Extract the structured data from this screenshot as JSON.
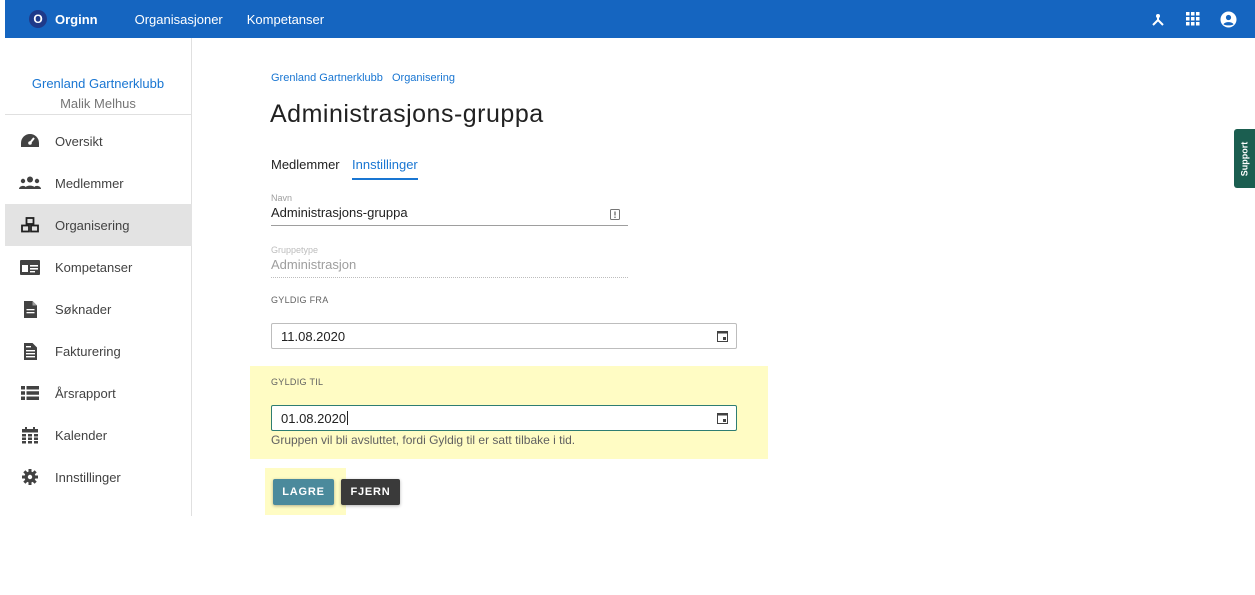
{
  "topbar": {
    "logo_letter": "O",
    "brand": "Orginn",
    "nav": [
      "Organisasjoner",
      "Kompetanser"
    ],
    "icons": [
      "network-icon",
      "apps-grid-icon",
      "account-circle-icon"
    ],
    "color": "#1565c0"
  },
  "sidebar": {
    "org_name": "Grenland Gartnerklubb",
    "user_name": "Malik Melhus",
    "items": [
      {
        "label": "Oversikt",
        "icon": "dashboard-gauge-icon",
        "active": false
      },
      {
        "label": "Medlemmer",
        "icon": "users-group-icon",
        "active": false
      },
      {
        "label": "Organisering",
        "icon": "cubes-icon",
        "active": true
      },
      {
        "label": "Kompetanser",
        "icon": "id-card-icon",
        "active": false
      },
      {
        "label": "Søknader",
        "icon": "document-icon",
        "active": false
      },
      {
        "label": "Fakturering",
        "icon": "invoice-icon",
        "active": false
      },
      {
        "label": "Årsrapport",
        "icon": "list-icon",
        "active": false
      },
      {
        "label": "Kalender",
        "icon": "calendar-icon",
        "active": false
      },
      {
        "label": "Innstillinger",
        "icon": "gear-icon",
        "active": false
      }
    ]
  },
  "breadcrumb": [
    "Grenland Gartnerklubb",
    "Organisering"
  ],
  "page_title": "Administrasjons-gruppa",
  "tabs": [
    {
      "label": "Medlemmer",
      "active": false
    },
    {
      "label": "Innstillinger",
      "active": true
    }
  ],
  "form": {
    "navn_label": "Navn",
    "navn_value": "Administrasjons-gruppa",
    "gruppetype_label": "Gruppetype",
    "gruppetype_value": "Administrasjon",
    "gyldig_fra_label": "GYLDIG FRA",
    "gyldig_fra_value": "11.08.2020",
    "gyldig_til_label": "GYLDIG TIL",
    "gyldig_til_value": "01.08.2020",
    "warning": "Gruppen vil bli avsluttet, fordi Gyldig til er satt tilbake i tid."
  },
  "buttons": {
    "save": "LAGRE",
    "remove": "FJERN"
  },
  "support_label": "Support",
  "colors": {
    "accent": "#1976d2",
    "highlight": "#fffcc4",
    "save_button": "#4b8a9c",
    "remove_button": "#3a3a3a",
    "support": "#1b5e50"
  }
}
